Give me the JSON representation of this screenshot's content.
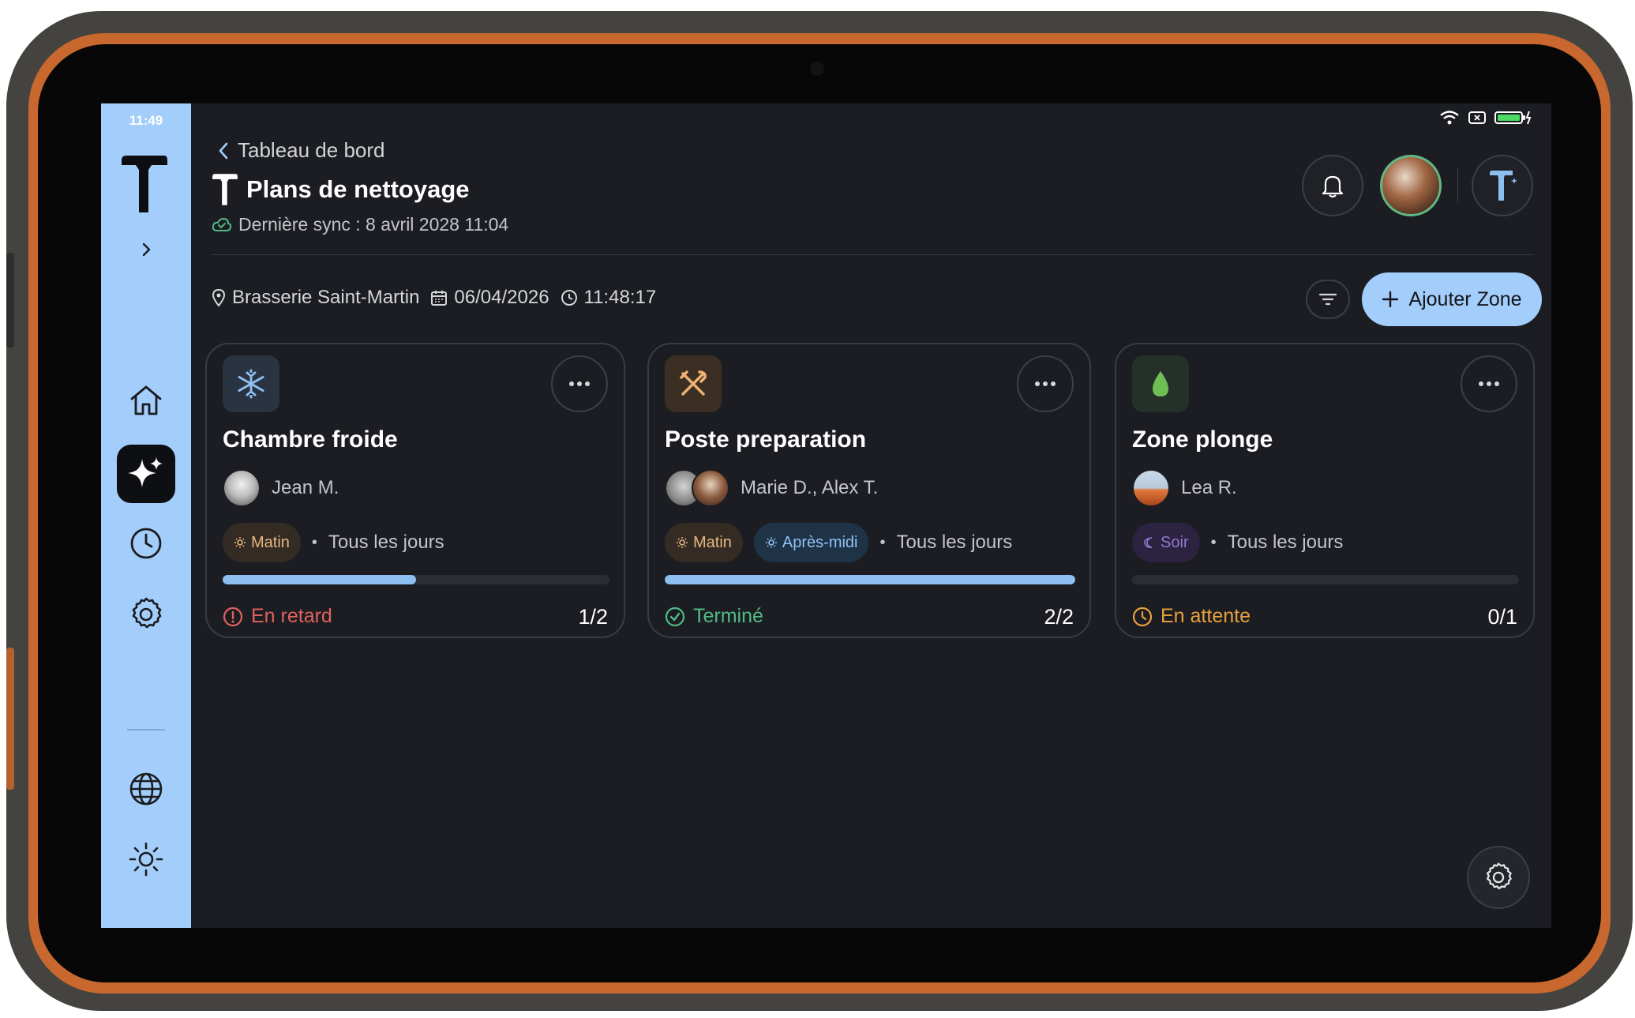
{
  "device": {
    "time": "11:49"
  },
  "header": {
    "back_label": "Tableau de bord",
    "title": "Plans de nettoyage",
    "sync_text": "Dernière sync : 8 avril 2028 11:04"
  },
  "toolbar": {
    "location": "Brasserie Saint-Martin",
    "date": "06/04/2026",
    "time": "11:48:17",
    "add_label": "Ajouter Zone"
  },
  "sidebar": {
    "items": [
      "home-icon",
      "sparkles-icon",
      "clock-icon",
      "gear-icon"
    ],
    "bottom_items": [
      "globe-icon",
      "sun-icon"
    ],
    "active": "sparkles-icon"
  },
  "colors": {
    "accent": "#a3cdfa",
    "background": "#1c1d22",
    "late": "#e0625e",
    "done": "#4fbb86",
    "pending": "#e8a23c"
  },
  "cards": [
    {
      "title": "Chambre froide",
      "icon": "snowflake-icon",
      "assignee": "Jean M.",
      "tags": [
        "Matin"
      ],
      "frequency": "Tous les jours",
      "progress": 0.5,
      "status": "En retard",
      "count": "1/2"
    },
    {
      "title": "Poste preparation",
      "icon": "utensils-icon",
      "assignee": "Marie D., Alex T.",
      "tags": [
        "Matin",
        "Après-midi"
      ],
      "frequency": "Tous les jours",
      "progress": 1.0,
      "status": "Terminé",
      "count": "2/2"
    },
    {
      "title": "Zone plonge",
      "icon": "water-drop-icon",
      "assignee": "Lea R.",
      "tags": [
        "Soir"
      ],
      "frequency": "Tous les jours",
      "progress": 0.0,
      "status": "En attente",
      "count": "0/1"
    }
  ]
}
